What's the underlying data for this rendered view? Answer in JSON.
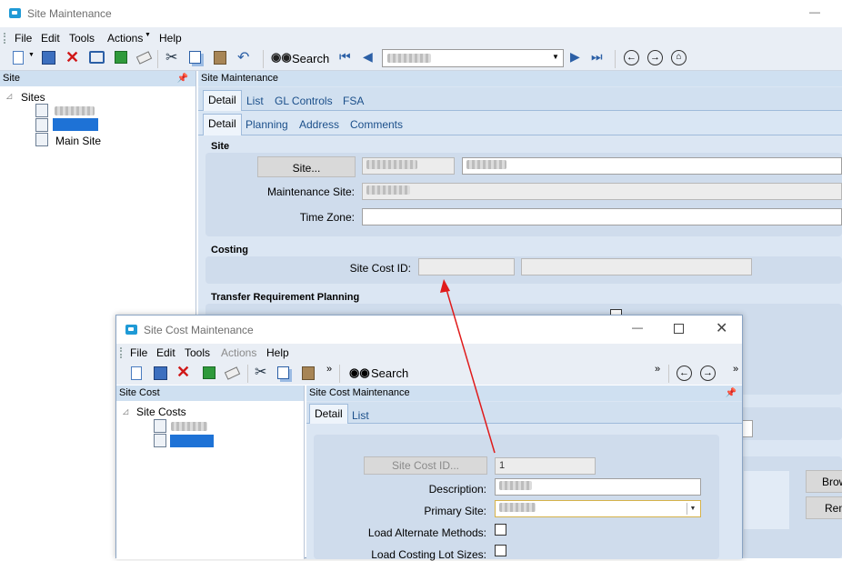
{
  "main_window": {
    "title": "Site Maintenance",
    "menu": [
      "File",
      "Edit",
      "Tools",
      "Actions",
      "Help"
    ],
    "toolbar": {
      "search_label": "Search"
    },
    "left_panel": {
      "header": "Site",
      "tree_root": "Sites",
      "tree_items": [
        "Main Site"
      ]
    },
    "right_panel": {
      "header": "Site Maintenance",
      "tabs": [
        "Detail",
        "List",
        "GL Controls",
        "FSA"
      ],
      "subtabs": [
        "Detail",
        "Planning",
        "Address",
        "Comments"
      ],
      "site_section": {
        "title": "Site",
        "site_button": "Site...",
        "maintenance_site_label": "Maintenance Site:",
        "time_zone_label": "Time Zone:"
      },
      "costing_section": {
        "title": "Costing",
        "site_cost_id_label": "Site Cost ID:"
      },
      "transfer_section": {
        "title": "Transfer Requirement Planning"
      },
      "right_buttons": [
        "Brow",
        "Rem"
      ]
    }
  },
  "dialog": {
    "title": "Site Cost Maintenance",
    "menu": [
      "File",
      "Edit",
      "Tools",
      "Actions",
      "Help"
    ],
    "toolbar": {
      "search_label": "Search"
    },
    "left_panel": {
      "header": "Site Cost",
      "tree_root": "Site Costs"
    },
    "right_panel": {
      "header": "Site Cost Maintenance",
      "tabs": [
        "Detail",
        "List"
      ],
      "site_cost_id_button": "Site Cost ID...",
      "site_cost_id_value": "1",
      "description_label": "Description:",
      "primary_site_label": "Primary Site:",
      "load_alt_methods_label": "Load Alternate Methods:",
      "load_costing_lot_label": "Load Costing Lot Sizes:"
    }
  },
  "colors": {
    "arrow": "#e01b1b",
    "panel_bg": "#dbe6f3",
    "header_bg": "#cfe0f1",
    "accent": "#1f9ad6"
  }
}
